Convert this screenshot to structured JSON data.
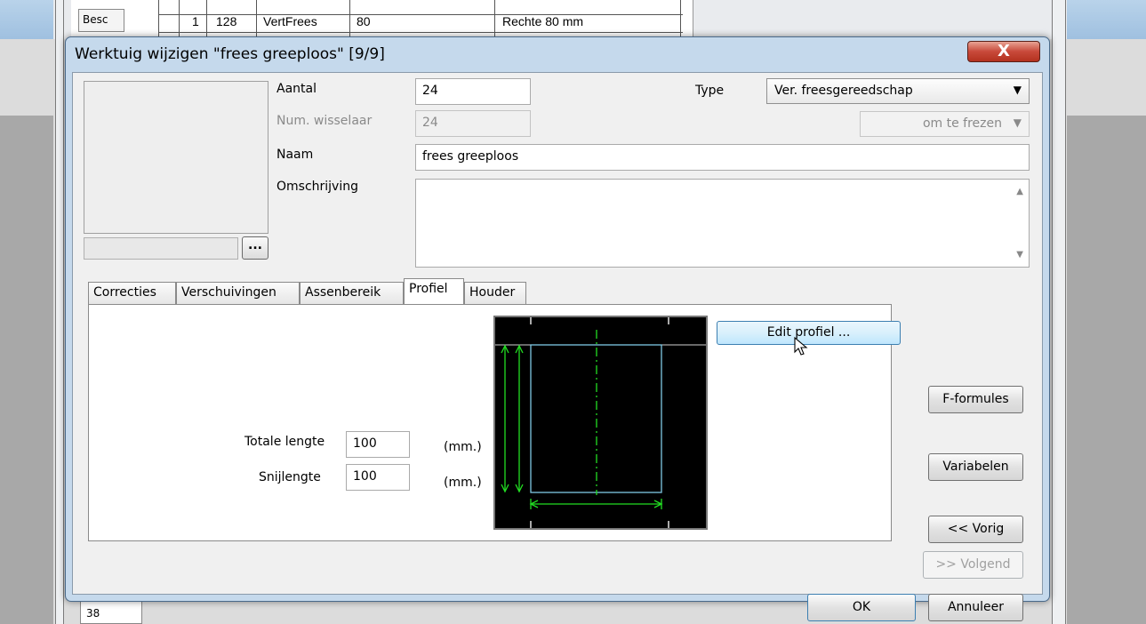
{
  "background": {
    "besc_label": "Besc",
    "row": {
      "index": "1",
      "id": "128",
      "tool": "VertFrees",
      "diameter": "80",
      "description": "Rechte 80 mm"
    },
    "bottom_row_number": "38"
  },
  "dialog": {
    "title": "Werktuig wijzigen \"frees greeploos\" [9/9]",
    "close_label": "X",
    "preview_button_label": "...",
    "fields": {
      "aantal": {
        "label": "Aantal",
        "value": "24"
      },
      "num_wisselaar": {
        "label": "Num. wisselaar",
        "value": "24"
      },
      "naam": {
        "label": "Naam",
        "value": "frees greeploos"
      },
      "omschrijving": {
        "label": "Omschrijving",
        "value": ""
      }
    },
    "type": {
      "label": "Type",
      "selected": "Ver. freesgereedschap"
    },
    "subtype": {
      "selected": "om te frezen"
    },
    "tabs": [
      {
        "label": "Correcties",
        "active": false
      },
      {
        "label": "Verschuivingen",
        "active": false
      },
      {
        "label": "Assenbereik",
        "active": false
      },
      {
        "label": "Profiel",
        "active": true
      },
      {
        "label": "Houder",
        "active": false
      }
    ],
    "profiel": {
      "totale_lengte": {
        "label": "Totale lengte",
        "value": "100",
        "unit": "(mm.)"
      },
      "snijlengte": {
        "label": "Snijlengte",
        "value": "100",
        "unit": "(mm.)"
      },
      "edit_button": "Edit profiel ..."
    },
    "side_buttons": {
      "f_formules": "F-formules",
      "variabelen": "Variabelen",
      "vorig": "<< Vorig",
      "volgend": ">> Volgend"
    },
    "footer": {
      "ok": "OK",
      "cancel": "Annuleer"
    }
  },
  "colors": {
    "profile_background": "#000000",
    "dimension_lines": "#22dd22",
    "tool_outline": "#7ec8e3",
    "close_button": "#c8493a",
    "hover_button": "#d9f0fc"
  }
}
